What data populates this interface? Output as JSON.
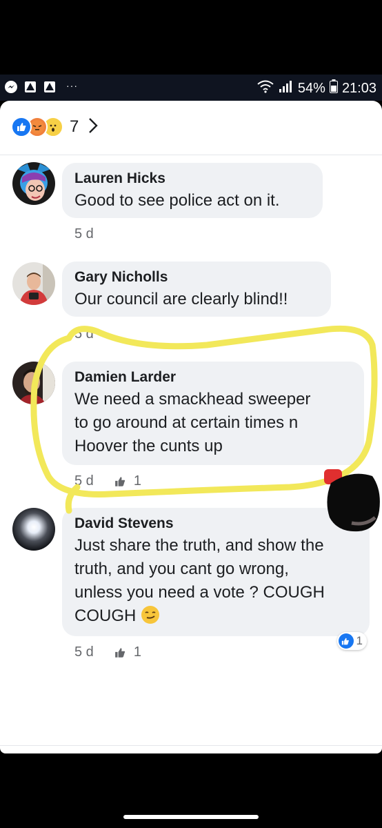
{
  "status_bar": {
    "notification_icons": [
      "messenger-icon",
      "warning-icon",
      "warning-icon"
    ],
    "dots": "···",
    "battery": "54%",
    "time": "21:03"
  },
  "reactions": {
    "icons": [
      "like-reaction-icon",
      "angry-reaction-icon",
      "wow-reaction-icon"
    ],
    "count": "7"
  },
  "comments": [
    {
      "name": "Lauren Hicks",
      "lines": [
        "Good to see police act on it."
      ],
      "time": "5 d",
      "likes": ""
    },
    {
      "name": "Gary Nicholls",
      "lines": [
        "Our council are clearly blind!!"
      ],
      "time": "5 d",
      "likes": ""
    },
    {
      "name": "Damien Larder",
      "lines": [
        "We need a smackhead sweeper",
        "to go around at certain times n",
        "Hoover the cunts up"
      ],
      "time": "5 d",
      "likes": "1"
    },
    {
      "name": "David Stevens",
      "lines": [
        "Just share the truth, and show the",
        "truth, and you cant go wrong,",
        "unless you need a vote ? COUGH",
        "COUGH"
      ],
      "time": "5 d",
      "likes": "1",
      "reaction_badge_count": "1"
    }
  ],
  "colors": {
    "facebook_blue": "#1877f2",
    "bubble": "#eff1f4",
    "annotation_highlight": "#f2e85a"
  }
}
